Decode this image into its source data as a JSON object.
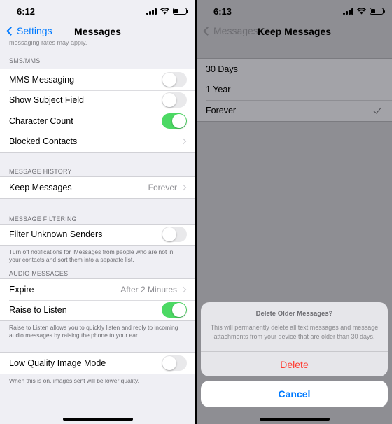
{
  "left": {
    "status": {
      "time": "6:12"
    },
    "nav": {
      "back_label": "Settings",
      "title": "Messages"
    },
    "peek_text": "messaging rates may apply.",
    "sections": {
      "sms": {
        "header": "SMS/MMS",
        "rows": {
          "mms": {
            "label": "MMS Messaging",
            "toggle": "off"
          },
          "subject": {
            "label": "Show Subject Field",
            "toggle": "off"
          },
          "count": {
            "label": "Character Count",
            "toggle": "on"
          },
          "blocked": {
            "label": "Blocked Contacts"
          }
        }
      },
      "history": {
        "header": "MESSAGE HISTORY",
        "keep": {
          "label": "Keep Messages",
          "value": "Forever"
        }
      },
      "filtering": {
        "header": "MESSAGE FILTERING",
        "filter": {
          "label": "Filter Unknown Senders",
          "toggle": "off"
        },
        "footer": "Turn off notifications for iMessages from people who are not in your contacts and sort them into a separate list."
      },
      "audio": {
        "header": "AUDIO MESSAGES",
        "expire": {
          "label": "Expire",
          "value": "After 2 Minutes"
        },
        "raise": {
          "label": "Raise to Listen",
          "toggle": "on"
        },
        "footer": "Raise to Listen allows you to quickly listen and reply to incoming audio messages by raising the phone to your ear."
      },
      "lowquality": {
        "label": "Low Quality Image Mode",
        "toggle": "off",
        "footer": "When this is on, images sent will be lower quality."
      }
    }
  },
  "right": {
    "status": {
      "time": "6:13"
    },
    "nav": {
      "back_label": "Messages",
      "title": "Keep Messages"
    },
    "options": [
      {
        "label": "30 Days"
      },
      {
        "label": "1 Year"
      },
      {
        "label": "Forever",
        "selected": true
      }
    ],
    "alert": {
      "title": "Delete Older Messages?",
      "message": "This will permanently delete all text messages and message attachments from your device that are older than 30 days.",
      "delete_label": "Delete",
      "cancel_label": "Cancel"
    }
  },
  "colors": {
    "accent": "#007aff",
    "toggle_on": "#4cd964",
    "destructive": "#ff3b30",
    "dim_bg": "#8e8e93"
  }
}
